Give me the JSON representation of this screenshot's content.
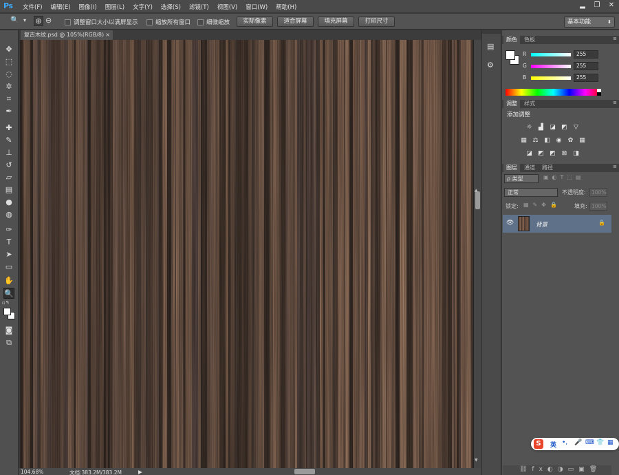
{
  "app": {
    "logo": "Ps"
  },
  "menu": [
    "文件(F)",
    "编辑(E)",
    "图像(I)",
    "图层(L)",
    "文字(Y)",
    "选择(S)",
    "滤镜(T)",
    "视图(V)",
    "窗口(W)",
    "帮助(H)"
  ],
  "window_controls": {
    "minimize": "▂",
    "restore": "❐",
    "close": "✕"
  },
  "options_bar": {
    "zoom_tool_icon": "🔍",
    "zoom_dropdown_arrow": "▾",
    "zoom_in_icon": "⊕",
    "zoom_out_icon": "⊖",
    "resize_windows_label": "调整窗口大小以满屏显示",
    "zoom_all_windows_label": "缩放所有窗口",
    "scrubby_zoom_label": "细微缩放",
    "actual_pixels": "实际像素",
    "fit_screen": "适合屏幕",
    "fill_screen": "填充屏幕",
    "print_size": "打印尺寸",
    "workspace": "基本功能"
  },
  "document": {
    "tab_title": "复古木纹.psd @ 105%(RGB/8)",
    "tab_close": "×",
    "zoom": "104.68%",
    "doc_info": "文档:383.2M/383.2M",
    "status_arrow": "▶"
  },
  "color_panel": {
    "tabs": [
      "颜色",
      "色板"
    ],
    "channels": [
      {
        "label": "R",
        "value": "255",
        "gradient": "linear-gradient(90deg,#00ffff,#ffffff)"
      },
      {
        "label": "G",
        "value": "255",
        "gradient": "linear-gradient(90deg,#ff00ff,#ffffff)"
      },
      {
        "label": "B",
        "value": "255",
        "gradient": "linear-gradient(90deg,#ffff00,#ffffff)"
      }
    ]
  },
  "adjustments_panel": {
    "tabs": [
      "调整",
      "样式"
    ],
    "add_label": "添加调整"
  },
  "layers_panel": {
    "tabs": [
      "图层",
      "通道",
      "路径"
    ],
    "filter_type": "ρ 类型",
    "blend_mode": "正常",
    "opacity_label": "不透明度:",
    "opacity_value": "100%",
    "lock_label": "锁定:",
    "fill_label": "填充:",
    "fill_value": "100%",
    "layer_name": "背景"
  },
  "ime": {
    "logo": "S",
    "lang": "英"
  },
  "colors": {
    "accent": "#3ea7f5",
    "layer_selected": "#5f7189",
    "panel": "#535353"
  }
}
